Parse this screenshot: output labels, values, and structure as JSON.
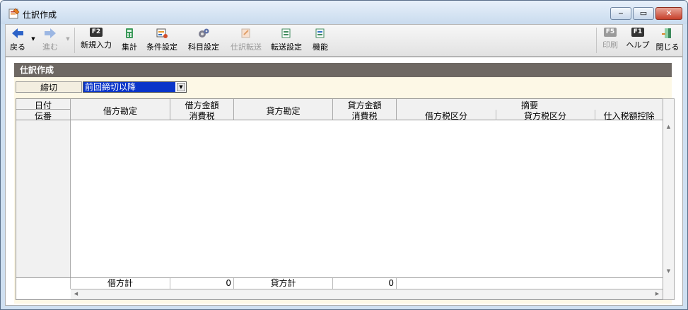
{
  "window": {
    "title": "仕訳作成",
    "minimize": "‒",
    "maximize": "▭",
    "close": "✕"
  },
  "toolbar": {
    "back": "戻る",
    "forward": "進む",
    "new_entry": {
      "key": "F2",
      "label": "新規入力"
    },
    "tally": "集計",
    "conditions": "条件設定",
    "account_settings": "科目設定",
    "journal_copy": "仕訳転送",
    "transfer_settings": "転送設定",
    "features": "機能",
    "print": {
      "key": "F5",
      "label": "印刷"
    },
    "help": {
      "key": "F1",
      "label": "ヘルプ"
    },
    "close": "閉じる"
  },
  "section_title": "仕訳作成",
  "filter": {
    "label": "締切",
    "value": "前回締切以降"
  },
  "grid": {
    "col_date": "日付",
    "col_slip": "伝番",
    "col_debit_account": "借方勘定",
    "col_debit_amount": "借方金額",
    "col_debit_tax": "消費税",
    "col_credit_account": "貸方勘定",
    "col_credit_amount": "貸方金額",
    "col_credit_tax": "消費税",
    "col_summary": "摘要",
    "col_debit_tax_class": "借方税区分",
    "col_credit_tax_class": "貸方税区分",
    "col_input_tax_deduction": "仕入税額控除"
  },
  "footer": {
    "debit_total_label": "借方計",
    "debit_total_value": "0",
    "credit_total_label": "貸方計",
    "credit_total_value": "0"
  },
  "colors": {
    "section_bar": "#6e6863",
    "panel": "#fdf8e6",
    "select_highlight": "#0a35c9"
  }
}
